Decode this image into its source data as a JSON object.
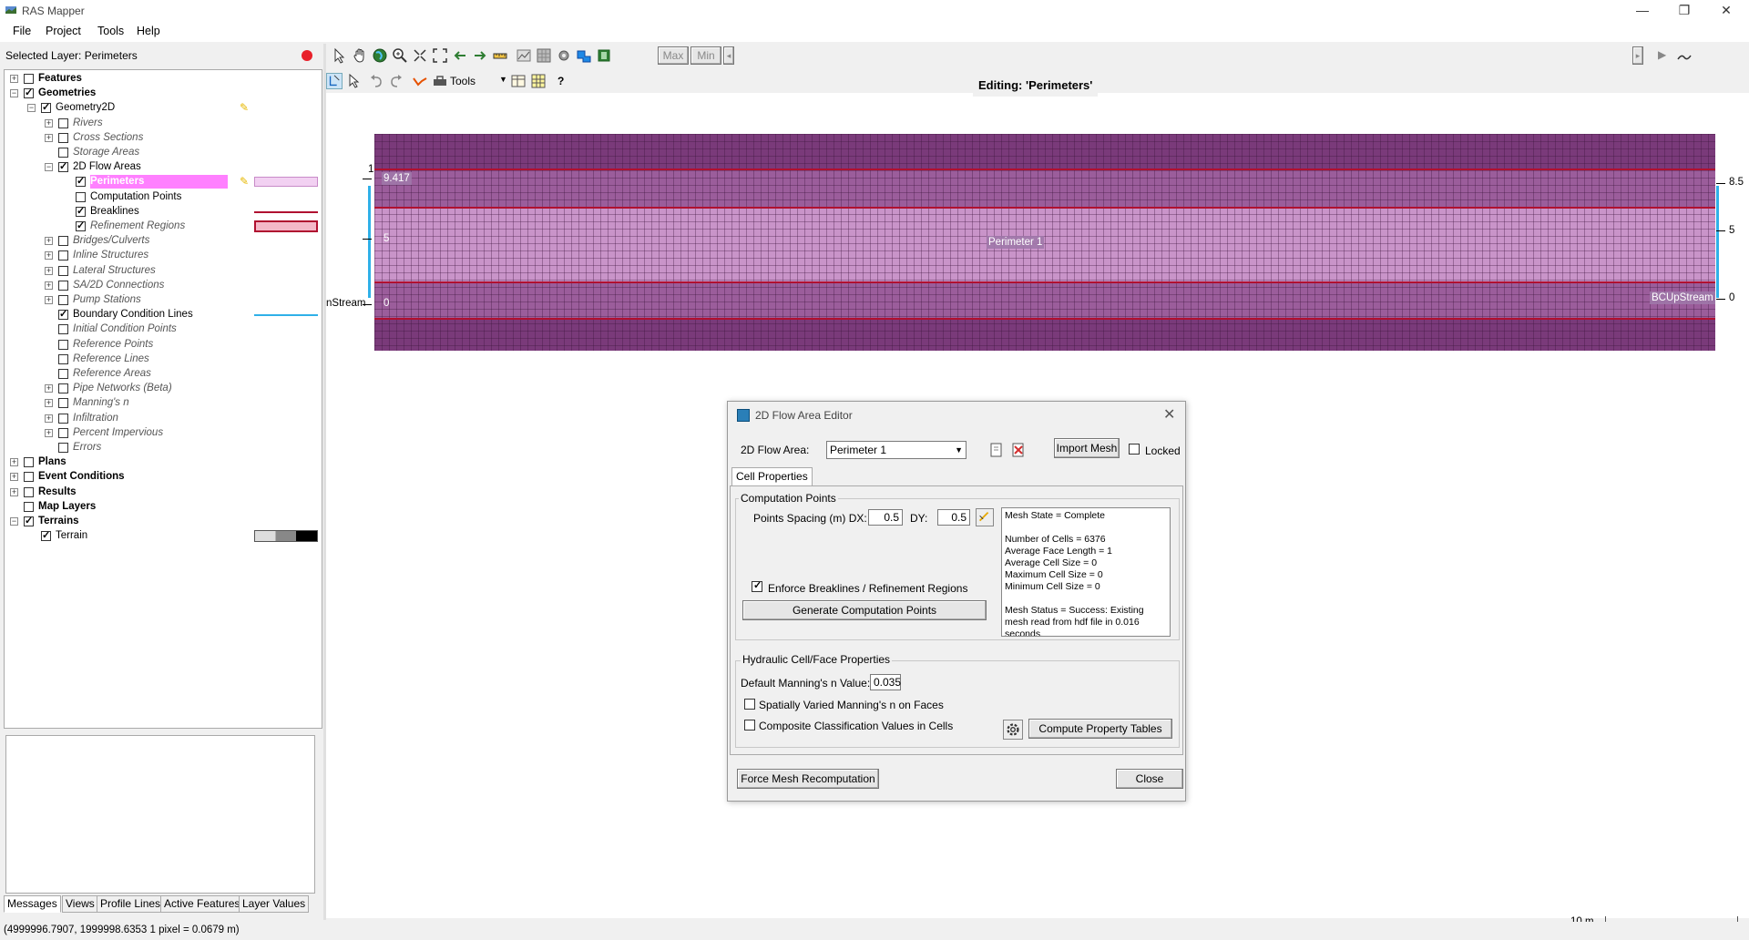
{
  "window": {
    "title": "RAS Mapper",
    "minimize": "—",
    "maximize": "❐",
    "close": "✕"
  },
  "menu": [
    "File",
    "Project",
    "Tools",
    "Help"
  ],
  "left_panel": {
    "selected_layer": "Selected Layer: Perimeters"
  },
  "tree": [
    {
      "label": "Features",
      "style": "bold",
      "checked": false
    },
    {
      "label": "Geometries",
      "style": "bold",
      "checked": true
    },
    {
      "label": "Geometry2D",
      "style": "normal",
      "checked": true
    },
    {
      "label": "Rivers",
      "style": "italic",
      "checked": false
    },
    {
      "label": "Cross Sections",
      "style": "italic",
      "checked": false
    },
    {
      "label": "Storage Areas",
      "style": "italic",
      "checked": false
    },
    {
      "label": "2D Flow Areas",
      "style": "normal",
      "checked": true
    },
    {
      "label": "Perimeters",
      "style": "selected",
      "checked": true
    },
    {
      "label": "Computation Points",
      "style": "normal",
      "checked": false
    },
    {
      "label": "Breaklines",
      "style": "normal",
      "checked": true
    },
    {
      "label": "Refinement Regions",
      "style": "italic",
      "checked": true
    },
    {
      "label": "Bridges/Culverts",
      "style": "italic",
      "checked": false
    },
    {
      "label": "Inline Structures",
      "style": "italic",
      "checked": false
    },
    {
      "label": "Lateral Structures",
      "style": "italic",
      "checked": false
    },
    {
      "label": "SA/2D Connections",
      "style": "italic",
      "checked": false
    },
    {
      "label": "Pump Stations",
      "style": "italic",
      "checked": false
    },
    {
      "label": "Boundary Condition Lines",
      "style": "normal",
      "checked": true
    },
    {
      "label": "Initial Condition Points",
      "style": "italic",
      "checked": false
    },
    {
      "label": "Reference Points",
      "style": "italic",
      "checked": false
    },
    {
      "label": "Reference Lines",
      "style": "italic",
      "checked": false
    },
    {
      "label": "Reference Areas",
      "style": "italic",
      "checked": false
    },
    {
      "label": "Pipe Networks (Beta)",
      "style": "italic",
      "checked": false
    },
    {
      "label": "Manning's n",
      "style": "italic",
      "checked": false
    },
    {
      "label": "Infiltration",
      "style": "italic",
      "checked": false
    },
    {
      "label": "Percent Impervious",
      "style": "italic",
      "checked": false
    },
    {
      "label": "Errors",
      "style": "italic",
      "checked": false
    },
    {
      "label": "Plans",
      "style": "bold",
      "checked": false
    },
    {
      "label": "Event Conditions",
      "style": "bold",
      "checked": false
    },
    {
      "label": "Results",
      "style": "bold",
      "checked": false
    },
    {
      "label": "Map Layers",
      "style": "bold",
      "checked": false
    },
    {
      "label": "Terrains",
      "style": "bold",
      "checked": true
    },
    {
      "label": "Terrain",
      "style": "normal",
      "checked": true
    }
  ],
  "bottom_tabs": [
    "Messages",
    "Views",
    "Profile Lines",
    "Active Features",
    "Layer Values"
  ],
  "status": {
    "coords": "(4999996.7907, 1999998.6353  1 pixel = 0.0679 m)"
  },
  "toolbar": {
    "max": "Max",
    "min": "Min",
    "tools": "Tools",
    "help": "?"
  },
  "map": {
    "editing": "Editing: 'Perimeters'",
    "perimeter_label": "Perimeter 1",
    "bc_right_label": "BCUpStream",
    "bc_left_label": "nStream",
    "left_value_label": "9.417",
    "left_mid_label": "5",
    "left_bottom_label": "0",
    "left_tick_top": "1",
    "right_ticks": [
      "8.5",
      "5",
      "0"
    ],
    "scale_label": "10 m"
  },
  "dialog": {
    "title": "2D Flow Area Editor",
    "flow_area_label": "2D Flow Area:",
    "flow_area_value": "Perimeter 1",
    "import_mesh": "Import Mesh",
    "locked": "Locked",
    "tab": "Cell Properties",
    "comp_points_group": "Computation Points",
    "spacing_label": "Points Spacing (m) DX:",
    "dx": "0.5",
    "dy_label": "DY:",
    "dy": "0.5",
    "enforce": "Enforce Breaklines / Refinement Regions",
    "generate": "Generate Computation Points",
    "mesh_info": [
      "Mesh State = Complete",
      "",
      "Number of Cells = 6376",
      "Average Face Length = 1",
      "Average Cell Size = 0",
      "Maximum Cell Size = 0",
      "Minimum Cell Size = 0",
      "",
      "Mesh Status = Success: Existing mesh read from hdf file in 0.016 seconds."
    ],
    "hydraulic_group": "Hydraulic Cell/Face Properties",
    "mannings_label": "Default Manning's n Value:",
    "mannings_value": "0.035",
    "spatially_varied": "Spatially Varied Manning's n on Faces",
    "composite": "Composite Classification Values in Cells",
    "compute_tables": "Compute Property Tables",
    "force_mesh": "Force Mesh Recomputation",
    "close": "Close"
  },
  "colors": {
    "mesh_dark": "#7a3a7a",
    "mesh_light": "#c994c9",
    "breakline": "#b01030",
    "bc_line": "#2fb0e8",
    "selected_row": "#ff80ff"
  }
}
